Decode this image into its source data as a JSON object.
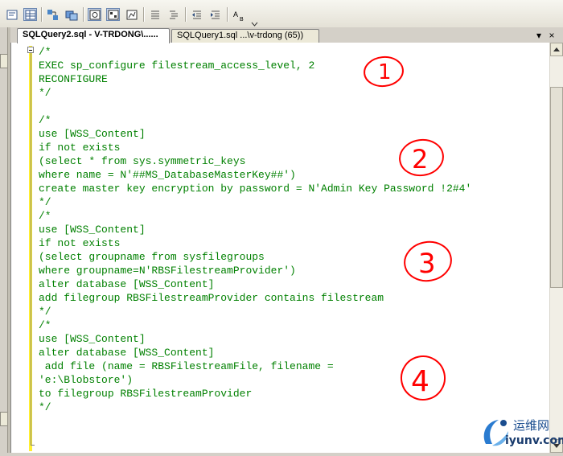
{
  "toolbar": {
    "buttons": [
      {
        "name": "results-to-text-icon"
      },
      {
        "name": "results-to-grid-icon"
      },
      {
        "name": "results-to-file-icon"
      },
      {
        "name": "include-actual-plan-icon"
      },
      {
        "name": "query-options-icon"
      },
      {
        "name": "display-plan-icon"
      },
      {
        "name": "client-statistics-icon"
      },
      {
        "name": "comment-lines-icon"
      },
      {
        "name": "uncomment-lines-icon"
      },
      {
        "name": "decrease-indent-icon"
      },
      {
        "name": "increase-indent-icon"
      },
      {
        "name": "specify-template-values-icon",
        "label": "A",
        "sub": "B"
      }
    ]
  },
  "tabs": [
    {
      "label": "SQLQuery2.sql - V-TRDONG\\......",
      "active": true
    },
    {
      "label": "SQLQuery1.sql ...\\v-trdong (65))",
      "active": false
    }
  ],
  "tab_controls": {
    "close": "×",
    "pin": "▾"
  },
  "editor": {
    "lines": [
      "/*",
      "EXEC sp_configure filestream_access_level, 2",
      "RECONFIGURE",
      "*/",
      "",
      "/*",
      "use [WSS_Content]",
      "if not exists",
      "(select * from sys.symmetric_keys",
      "where name = N'##MS_DatabaseMasterKey##')",
      "create master key encryption by password = N'Admin Key Password !2#4'",
      "*/",
      "/*",
      "use [WSS_Content]",
      "if not exists",
      "(select groupname from sysfilegroups",
      "where groupname=N'RBSFilestreamProvider')",
      "alter database [WSS_Content]",
      "add filegroup RBSFilestreamProvider contains filestream",
      "*/",
      "/*",
      "use [WSS_Content]",
      "alter database [WSS_Content]",
      " add file (name = RBSFilestreamFile, filename =",
      "'e:\\Blobstore')",
      "to filegroup RBSFilestreamProvider",
      "*/"
    ],
    "text_color": "#008000",
    "margin_color": "#ffef31"
  },
  "annotations": {
    "color": "#ff0000",
    "marks": [
      "1",
      "2",
      "3",
      "4"
    ]
  },
  "watermark": {
    "brand": "运维网",
    "domain": "iyunv.com",
    "color": "#1a4d8f"
  }
}
